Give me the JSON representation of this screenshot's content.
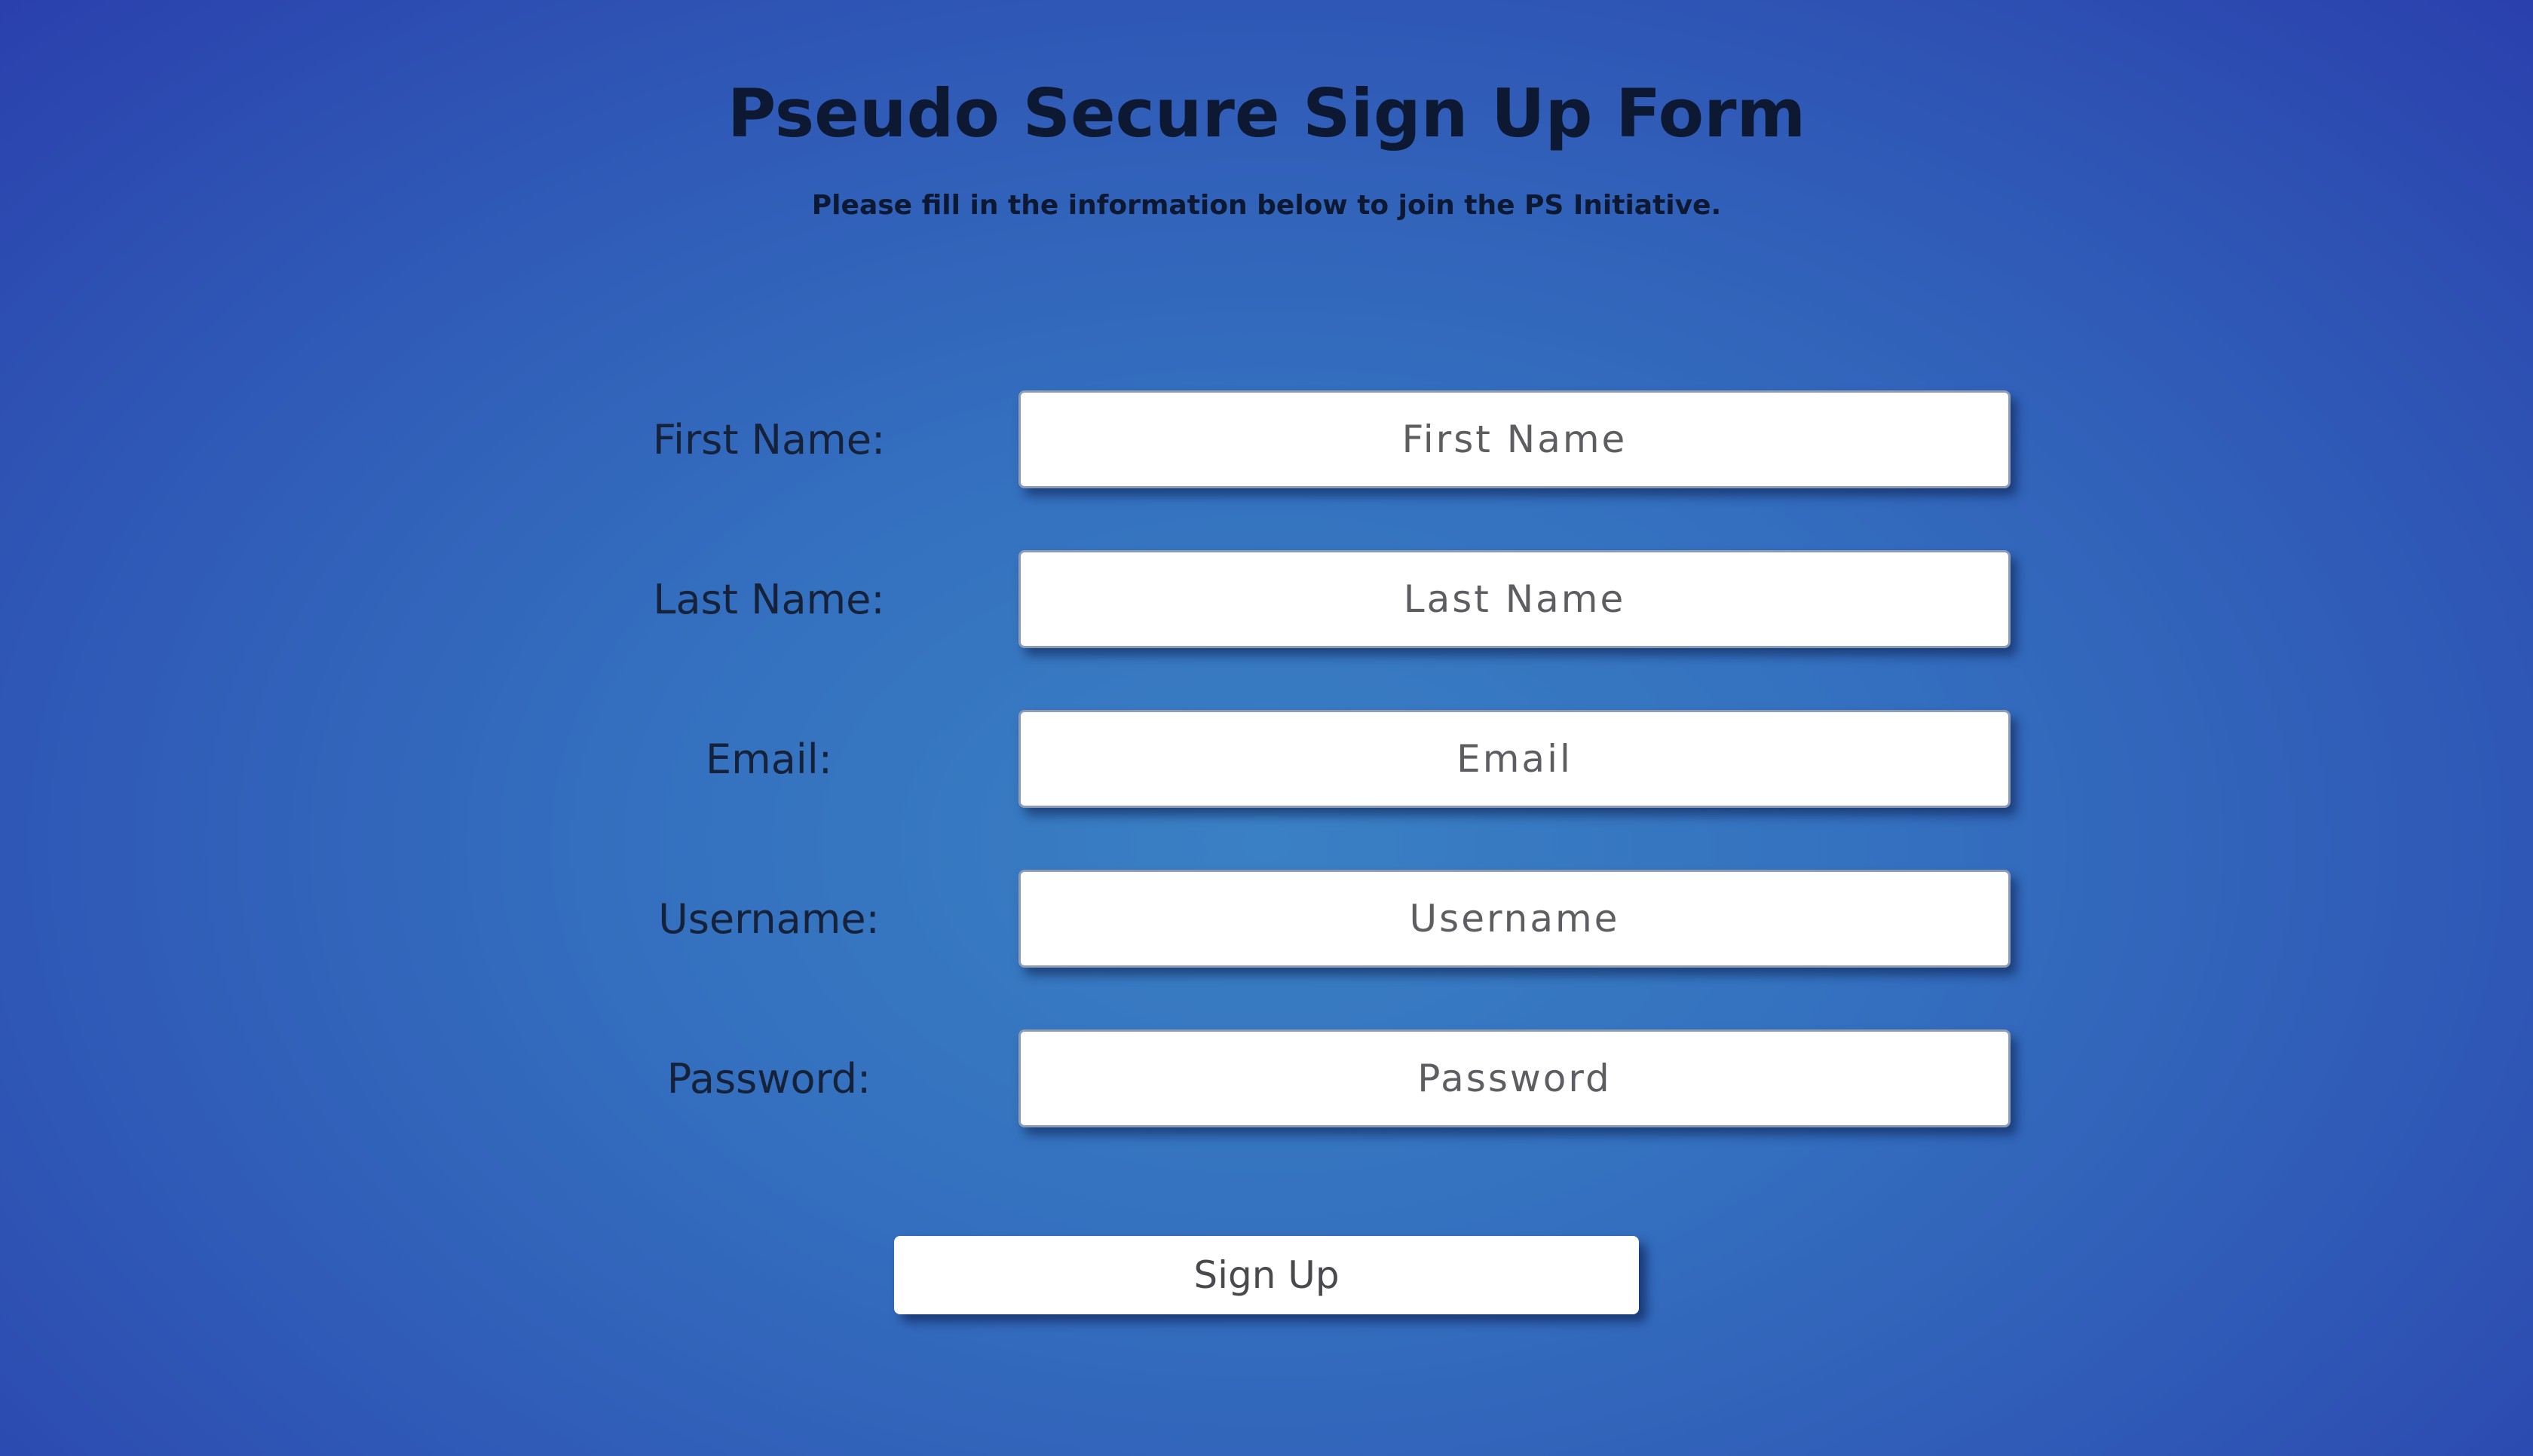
{
  "header": {
    "title": "Pseudo Secure Sign Up Form",
    "subtitle": "Please fill in the information below to join the PS Initiative."
  },
  "form": {
    "fields": [
      {
        "label": "First Name:",
        "placeholder": "First Name",
        "value": ""
      },
      {
        "label": "Last Name:",
        "placeholder": "Last Name",
        "value": ""
      },
      {
        "label": "Email:",
        "placeholder": "Email",
        "value": ""
      },
      {
        "label": "Username:",
        "placeholder": "Username",
        "value": ""
      },
      {
        "label": "Password:",
        "placeholder": "Password",
        "value": ""
      }
    ],
    "submit_label": "Sign Up"
  },
  "colors": {
    "background_center": "#3a80c4",
    "background_edge": "#2a40ad",
    "heading_text": "#0d1833",
    "label_text": "#16223a",
    "input_background": "#ffffff",
    "placeholder_text": "#5e5e62"
  }
}
